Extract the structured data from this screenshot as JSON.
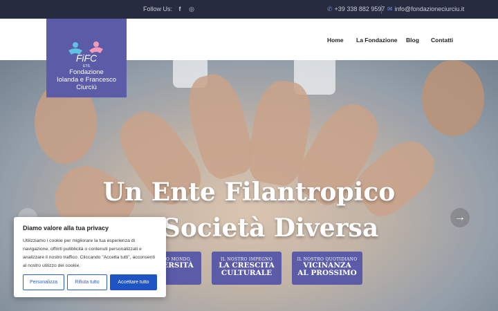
{
  "topbar": {
    "follow_label": "Follow Us:",
    "facebook_icon": "f",
    "instagram_icon": "◎",
    "phone_icon": "✆",
    "phone": "+39 338 882 9597",
    "mail_icon": "✉",
    "email": "info@fondazioneciurciu.it"
  },
  "logo": {
    "line1": "Fondazione",
    "line2": "Iolanda e Francesco",
    "line3": "Ciurciù"
  },
  "nav": {
    "home": "Home",
    "fondazione": "La Fondazione",
    "blog": "Blog",
    "contatti": "Contatti"
  },
  "hero": {
    "title_line1": "Un Ente Filantropico",
    "title_line2": "na Società Diversa",
    "badges": [
      {
        "small": "O MONDO",
        "big": "ERSITÀ"
      },
      {
        "small": "IL NOSTRO IMPEGNO",
        "big1": "LA CRESCITA",
        "big2": "CULTURALE"
      },
      {
        "small": "IL NOSTRO QUOTIDIANO",
        "big1": "VICINANZA",
        "big2": "AL PROSSIMO"
      }
    ],
    "arrow_left": "←",
    "arrow_right": "→"
  },
  "cookie": {
    "title": "Diamo valore alla tua privacy",
    "text": "Utilizziamo i cookie per migliorare la tua esperienza di navigazione, offrirti pubblicità o contenuti personalizzati e analizzare il nostro traffico. Cliccando \"Accetta tutti\", acconsenti al nostro utilizzo dei cookie.",
    "btn_personalizza": "Personalizza",
    "btn_rifiuta": "Rifiuta tutto",
    "btn_accetta": "Accettare tutto"
  },
  "colors": {
    "topbar": "#262b40",
    "brand": "#5b5ba8",
    "accent": "#1f54c4"
  }
}
